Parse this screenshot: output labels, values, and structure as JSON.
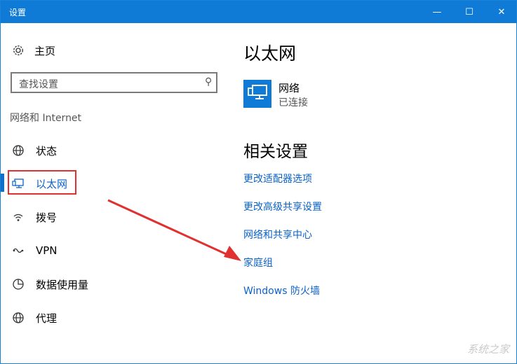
{
  "window": {
    "title": "设置",
    "minimize_glyph": "—",
    "maximize_glyph": "☐",
    "close_glyph": "✕"
  },
  "sidebar": {
    "home_label": "主页",
    "search_placeholder": "查找设置",
    "section_title": "网络和 Internet",
    "items": [
      {
        "label": "状态",
        "icon": "globe-icon"
      },
      {
        "label": "以太网",
        "icon": "monitor-icon"
      },
      {
        "label": "拨号",
        "icon": "dialup-icon"
      },
      {
        "label": "VPN",
        "icon": "vpn-icon"
      },
      {
        "label": "数据使用量",
        "icon": "pie-icon"
      },
      {
        "label": "代理",
        "icon": "globe-icon"
      }
    ]
  },
  "main": {
    "heading": "以太网",
    "network": {
      "name": "网络",
      "status": "已连接"
    },
    "related_heading": "相关设置",
    "links": [
      "更改适配器选项",
      "更改高级共享设置",
      "网络和共享中心",
      "家庭组",
      "Windows 防火墙"
    ]
  },
  "colors": {
    "titlebar": "#0f7bd6",
    "accent": "#0a62c9",
    "highlight": "#e03030",
    "arrow": "#e03030"
  },
  "watermark": "系统之家"
}
